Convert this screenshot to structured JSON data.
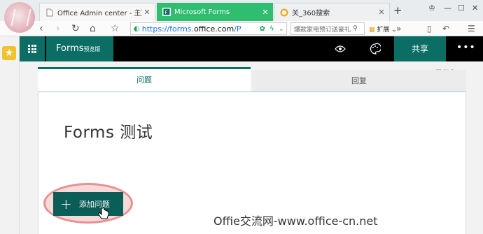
{
  "browser": {
    "tabs": [
      {
        "label": "Office Admin center - 主页",
        "active": false
      },
      {
        "label": "Microsoft Forms",
        "active": true
      },
      {
        "label": "关_360搜索",
        "active": false
      }
    ],
    "new_tab": "+",
    "address": {
      "prefix": "https://forms.",
      "domain": "office.com",
      "suffix": "/P"
    },
    "search_text": "爆款家电预订送豪礼",
    "extension_label": "扩展",
    "accent_color": "#2fbd6f"
  },
  "forms": {
    "brand": "Forms",
    "brand_badge": "预览版",
    "share_label": "共享",
    "more_label": "•••",
    "saved_status": "已保存",
    "tabs": [
      {
        "label": "问题",
        "active": true
      },
      {
        "label": "回复",
        "active": false
      }
    ],
    "form_title": "Forms 测试",
    "add_question_label": "添加问题",
    "theme_color": "#0b6d63"
  },
  "watermark": "Offie交流网-www.office-cn.net"
}
